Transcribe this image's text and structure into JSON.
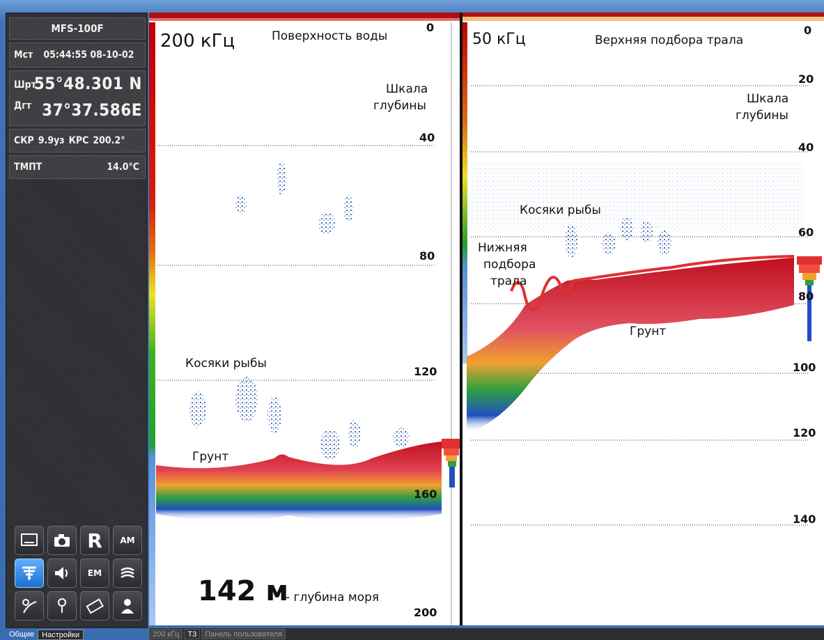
{
  "sidebar": {
    "model": "MFS-100F",
    "time": {
      "label": "Мст",
      "value": "05:44:55 08-10-02"
    },
    "latitude": {
      "label": "Шрт",
      "value": "55°48.301 N"
    },
    "longitude": {
      "label": "Дгт",
      "value": "37°37.586E"
    },
    "speed": {
      "label": "СКР",
      "value": "9.9уз"
    },
    "course": {
      "label": "КРС",
      "value": "200.2°"
    },
    "temperature": {
      "label": "ТМПТ",
      "value": "14.0°С"
    },
    "tools": [
      {
        "icon": "monitor-icon"
      },
      {
        "icon": "camera-icon"
      },
      {
        "icon": "record-icon",
        "text": "R"
      },
      {
        "icon": "am-icon",
        "text": "AM"
      },
      {
        "icon": "echo-filter-icon",
        "active": true
      },
      {
        "icon": "speaker-icon"
      },
      {
        "icon": "em-icon",
        "text": "EM"
      },
      {
        "icon": "sonar-waves-icon"
      },
      {
        "icon": "trawl-curve-icon"
      },
      {
        "icon": "probe-icon"
      },
      {
        "icon": "film-icon"
      },
      {
        "icon": "user-icon"
      }
    ],
    "tabs": [
      "Общие",
      "Настройки"
    ]
  },
  "left_panel": {
    "frequency": "200 кГц",
    "surface_label": "Поверхность воды",
    "scale_label_1": "Шкала",
    "scale_label_2": "глубины",
    "fish_label": "Косяки  рыбы",
    "ground_label": "Грунт",
    "depth_value": "142 м",
    "depth_caption": "-   глубина моря",
    "depth_marks": [
      "0",
      "40",
      "80",
      "120",
      "160",
      "200"
    ]
  },
  "right_panel": {
    "frequency": "50 кГц",
    "headrope_label": "Верхняя  подбора  трала",
    "scale_label_1": "Шкала",
    "scale_label_2": "глубины",
    "fish_label": "Косяки  рыбы",
    "footrope_label_1": "Нижняя",
    "footrope_label_2": "подбора",
    "footrope_label_3": "трала",
    "ground_label": "Грунт",
    "depth_marks": [
      "0",
      "20",
      "40",
      "60",
      "80",
      "100",
      "120",
      "140"
    ]
  },
  "bottom_tabs": [
    "200 кГц",
    "Т3",
    "Панель пользователя"
  ]
}
